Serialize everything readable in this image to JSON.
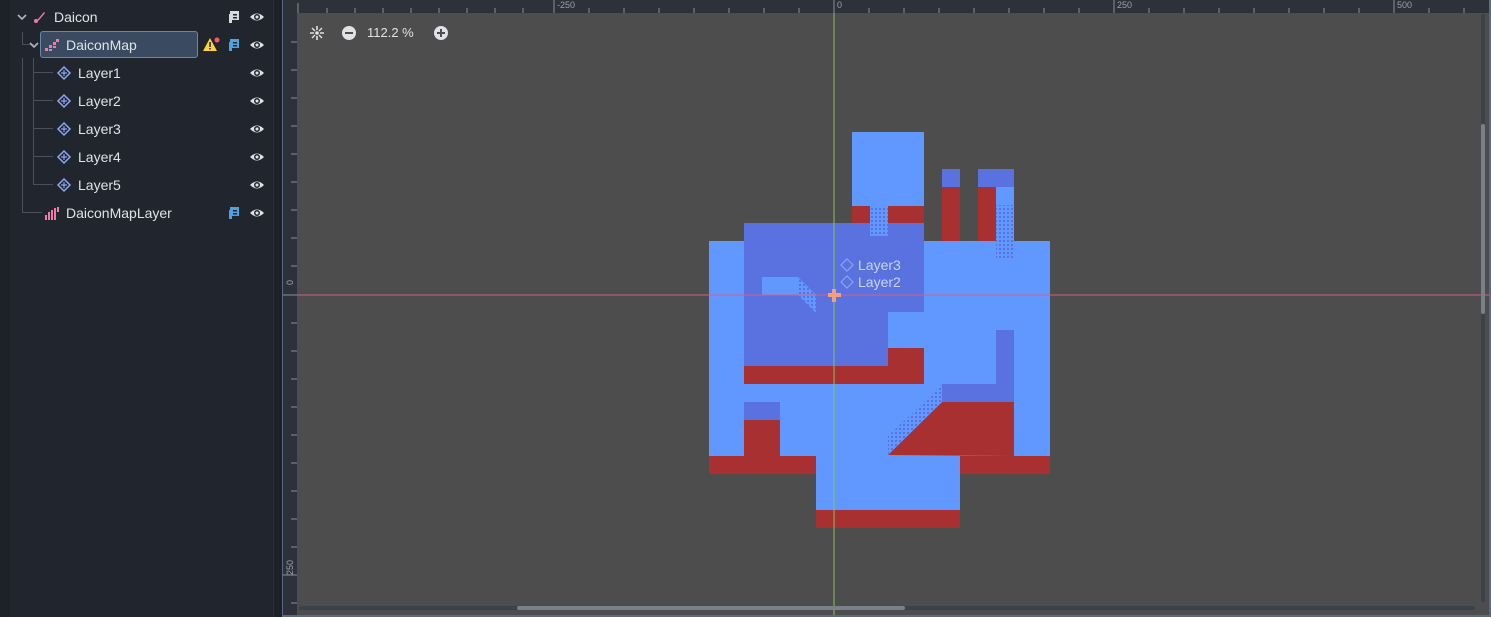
{
  "scene_tree": {
    "nodes": [
      {
        "label": "Daicon",
        "has_script": true,
        "visible": true
      },
      {
        "label": "DaiconMap",
        "has_script": true,
        "has_warning": true,
        "visible": true,
        "selected": true
      },
      {
        "label": "Layer1",
        "visible": true
      },
      {
        "label": "Layer2",
        "visible": true
      },
      {
        "label": "Layer3",
        "visible": true
      },
      {
        "label": "Layer4",
        "visible": true
      },
      {
        "label": "Layer5",
        "visible": true
      },
      {
        "label": "DaiconMapLayer",
        "has_script": true,
        "visible": true
      }
    ]
  },
  "viewport": {
    "zoom_label": "112.2 %",
    "ruler_top_labels": [
      "-250",
      "0",
      "250",
      "500"
    ],
    "ruler_left_labels": [
      "0",
      "250"
    ],
    "canvas_labels": [
      "Layer3",
      "Layer2"
    ]
  },
  "colors": {
    "light_blue": "#6098ff",
    "mid_blue": "#5a72e0",
    "dark_red": "#a83030",
    "viewport_bg": "#4d4d4d",
    "axis_x": "#d0608a",
    "axis_y": "#8ac060"
  },
  "icons": [
    "collapse-arrow-icon",
    "scene-root-icon",
    "tilemap-icon",
    "tilemap-layer-icon",
    "warning-icon",
    "script-icon",
    "eye-icon",
    "zoom-out-icon",
    "zoom-in-icon",
    "center-view-icon",
    "origin-cross-icon"
  ]
}
